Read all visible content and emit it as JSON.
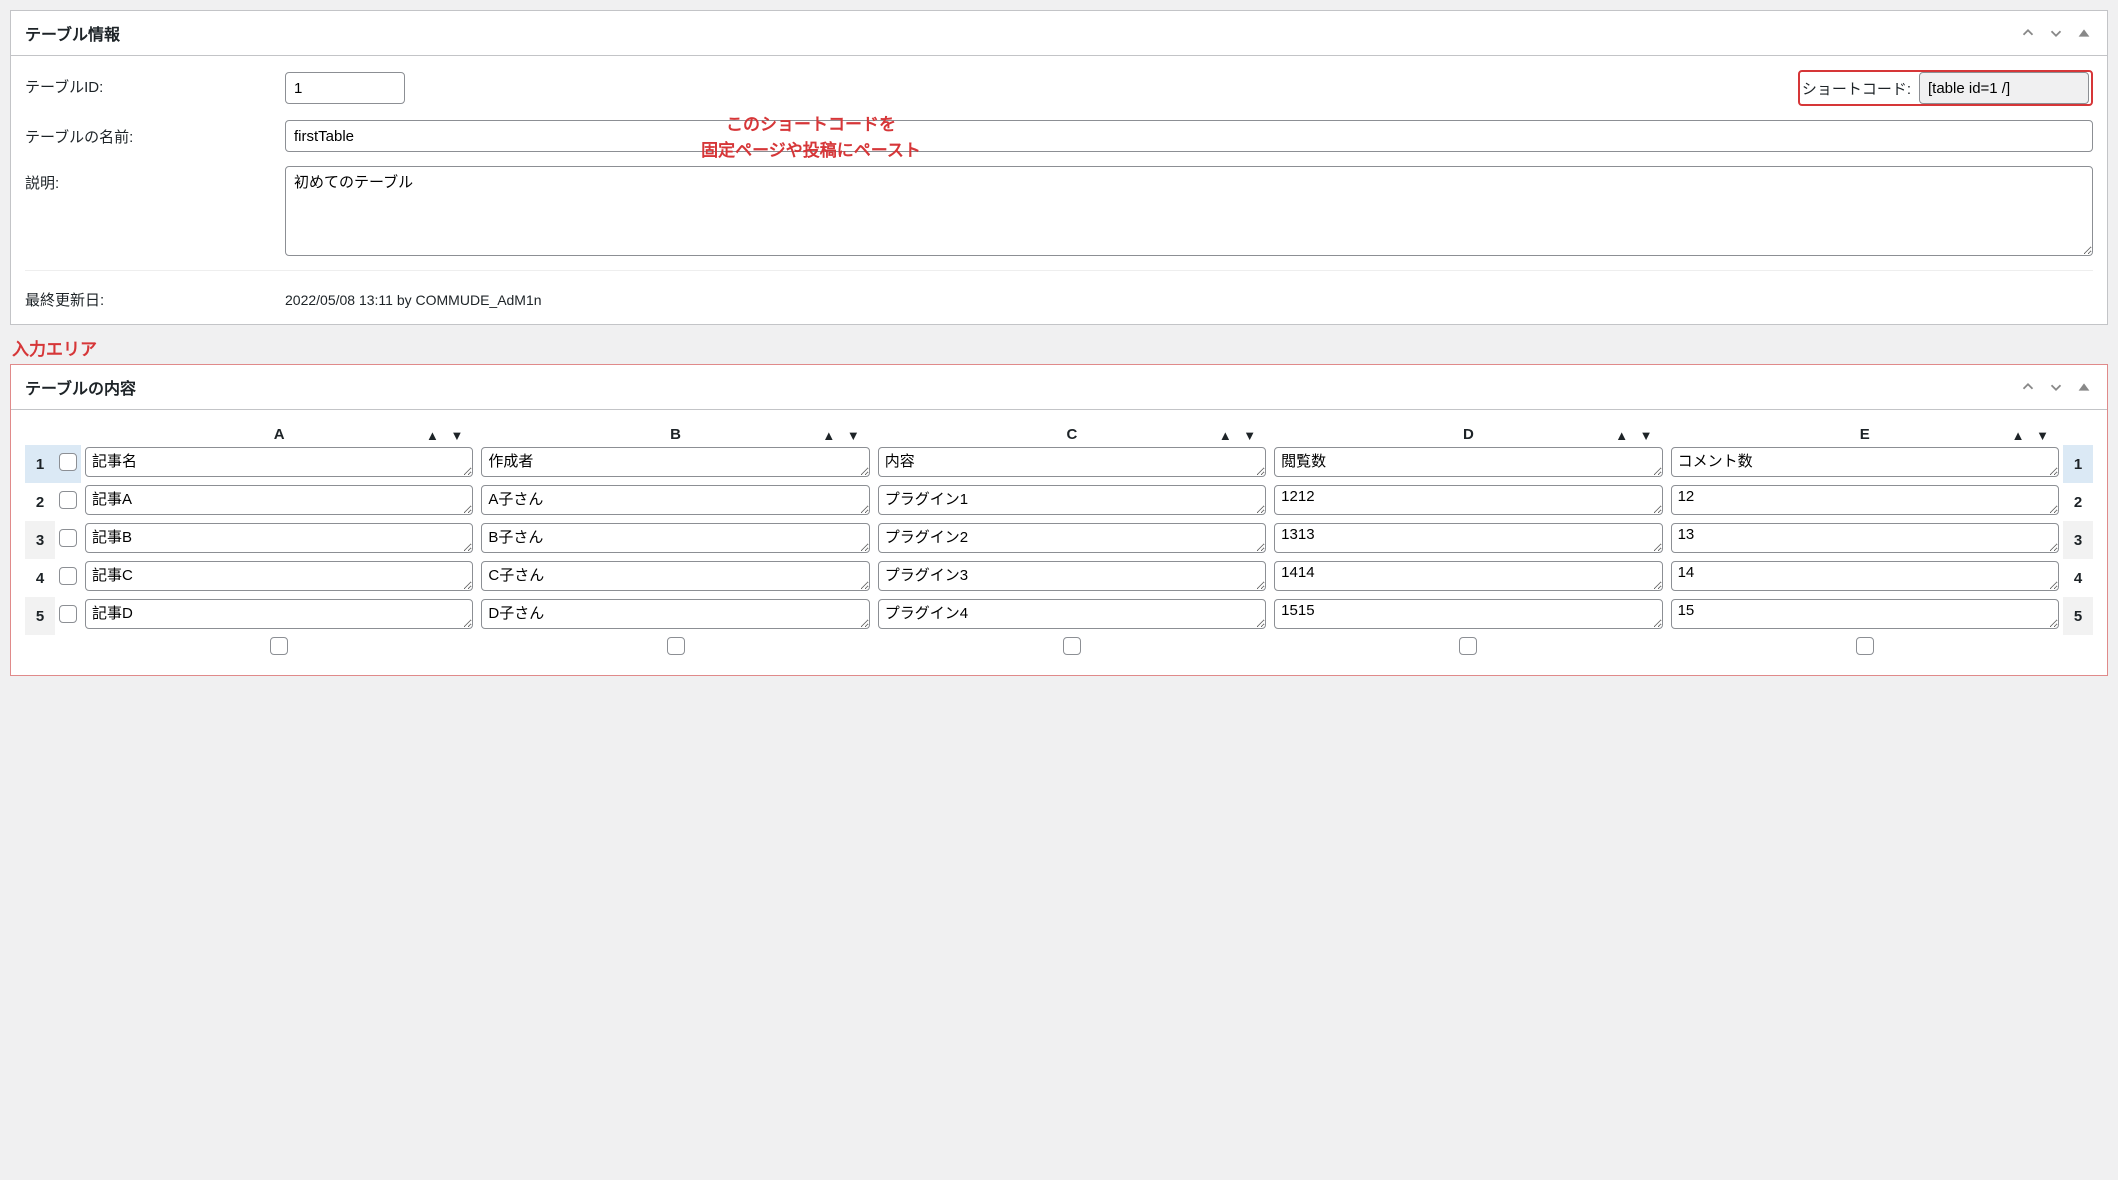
{
  "panel1": {
    "title": "テーブル情報",
    "labels": {
      "tableId": "テーブルID:",
      "tableName": "テーブルの名前:",
      "description": "説明:",
      "shortcode": "ショートコード:",
      "lastModified": "最終更新日:"
    },
    "values": {
      "tableId": "1",
      "tableName": "firstTable",
      "description": "初めてのテーブル",
      "shortcode": "[table id=1 /]",
      "lastModified": "2022/05/08 13:11 by COMMUDE_AdM1n"
    },
    "overlay": "このショートコードを\n固定ページや投稿にペースト"
  },
  "inputAreaLabel": "入力エリア",
  "panel2": {
    "title": "テーブルの内容",
    "columns": [
      "A",
      "B",
      "C",
      "D",
      "E"
    ],
    "rows": [
      {
        "num": "1",
        "cells": [
          "記事名",
          "作成者",
          "内容",
          "閲覧数",
          "コメント数"
        ]
      },
      {
        "num": "2",
        "cells": [
          "記事A",
          "A子さん",
          "プラグイン1",
          "1212",
          "12"
        ]
      },
      {
        "num": "3",
        "cells": [
          "記事B",
          "B子さん",
          "プラグイン2",
          "1313",
          "13"
        ]
      },
      {
        "num": "4",
        "cells": [
          "記事C",
          "C子さん",
          "プラグイン3",
          "1414",
          "14"
        ]
      },
      {
        "num": "5",
        "cells": [
          "記事D",
          "D子さん",
          "プラグイン4",
          "1515",
          "15"
        ]
      }
    ]
  }
}
